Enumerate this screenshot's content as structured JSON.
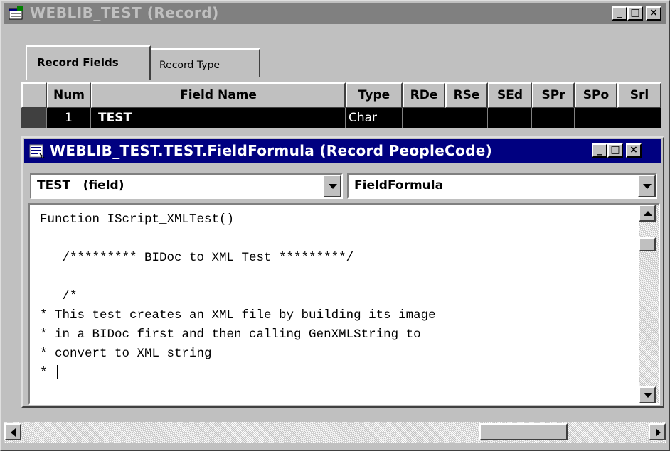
{
  "window": {
    "title": "WEBLIB_TEST (Record)",
    "icon": "record-window-icon",
    "minimize_label": "_",
    "maximize_label": "□",
    "close_label": "×"
  },
  "tabs": [
    {
      "label": "Record Fields",
      "selected": true
    },
    {
      "label": "Record Type",
      "selected": false
    }
  ],
  "grid": {
    "columns": [
      "Num",
      "Field Name",
      "Type",
      "RDe",
      "RSe",
      "SEd",
      "SPr",
      "SPo",
      "Srl"
    ],
    "rows": [
      {
        "num": "1",
        "field_name": "TEST",
        "type": "Char",
        "selected": true
      }
    ]
  },
  "peoplecode_window": {
    "title": "WEBLIB_TEST.TEST.FieldFormula (Record PeopleCode)",
    "icon": "peoplecode-document-icon",
    "field_combo_value": "TEST   (field)",
    "event_combo_value": "FieldFormula",
    "code_lines": [
      "Function IScript_XMLTest()",
      "",
      "   /********* BIDoc to XML Test *********/",
      "",
      "   /*",
      "* This test creates an XML file by building its image",
      "* in a BIDoc first and then calling GenXMLString to",
      "* convert to XML string",
      "*"
    ]
  },
  "colors": {
    "active_title": "#000080",
    "inactive_title": "#808080",
    "selection": "#000000",
    "face": "#c0c0c0"
  }
}
